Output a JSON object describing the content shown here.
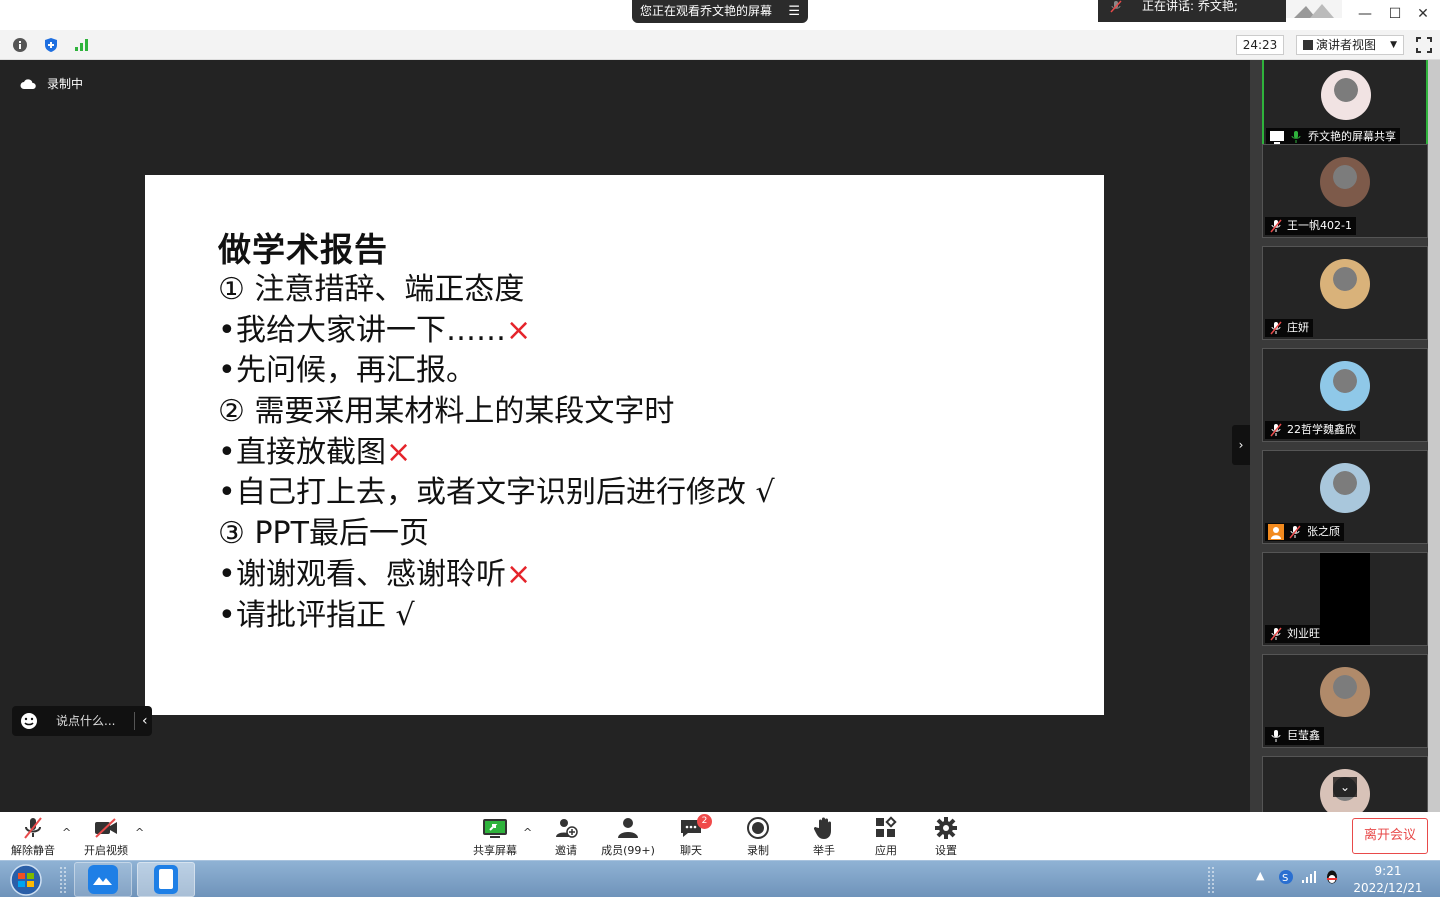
{
  "top": {
    "viewing_label": "您正在观看乔文艳的屏幕",
    "speaking_label": "正在讲话: 乔文艳;"
  },
  "info_bar": {
    "timer": "24:23",
    "view_mode": "演讲者视图"
  },
  "recording": {
    "label": "录制中"
  },
  "slide": {
    "title": "做学术报告",
    "lines": [
      {
        "prefix": "① ",
        "text": "注意措辞、端正态度",
        "mark": ""
      },
      {
        "prefix": "•",
        "text": "我给大家讲一下……",
        "mark": "×"
      },
      {
        "prefix": "•",
        "text": "先问候，再汇报。",
        "mark": ""
      },
      {
        "prefix": "② ",
        "text": "需要采用某材料上的某段文字时",
        "mark": ""
      },
      {
        "prefix": "•",
        "text": "直接放截图",
        "mark": "×"
      },
      {
        "prefix": "•",
        "text": "自己打上去，或者文字识别后进行修改 √",
        "mark": ""
      },
      {
        "prefix": "③ ",
        "text": "PPT最后一页",
        "mark": ""
      },
      {
        "prefix": "•",
        "text": "谢谢观看、感谢聆听",
        "mark": "×"
      },
      {
        "prefix": "•",
        "text": "请批评指正 √",
        "mark": ""
      }
    ]
  },
  "chat": {
    "placeholder": "说点什么..."
  },
  "participants": [
    {
      "name": "乔文艳的屏幕共享",
      "avatar_color": "#f1e3e3",
      "muted": false,
      "sharing": true
    },
    {
      "name": "王一帆402-1",
      "avatar_color": "#7d5a4a",
      "muted": true
    },
    {
      "name": "庄妍",
      "avatar_color": "#d9b27a",
      "muted": true
    },
    {
      "name": "22哲学魏鑫欣",
      "avatar_color": "#8fc8e8",
      "muted": true
    },
    {
      "name": "张之颀",
      "avatar_color": "#a9c7dc",
      "muted": true,
      "host": true
    },
    {
      "name": "刘业旺",
      "avatar_color": "#000000",
      "muted": true
    },
    {
      "name": "巨莹鑫",
      "avatar_color": "#b08a6a",
      "muted": false
    },
    {
      "name": "",
      "avatar_color": "#d8c2b8",
      "muted": false
    }
  ],
  "toolbar": {
    "unmute": "解除静音",
    "start_video": "开启视频",
    "share_screen": "共享屏幕",
    "invite": "邀请",
    "members": "成员(99+)",
    "chat": "聊天",
    "chat_badge": "2",
    "record": "录制",
    "raise_hand": "举手",
    "apps": "应用",
    "settings": "设置",
    "leave": "离开会议"
  },
  "taskbar": {
    "time": "9:21",
    "date": "2022/12/21"
  },
  "colors": {
    "accent_green": "#2fb33c",
    "leave_red": "#e84a4a",
    "wrong_mark": "#e5242b"
  }
}
